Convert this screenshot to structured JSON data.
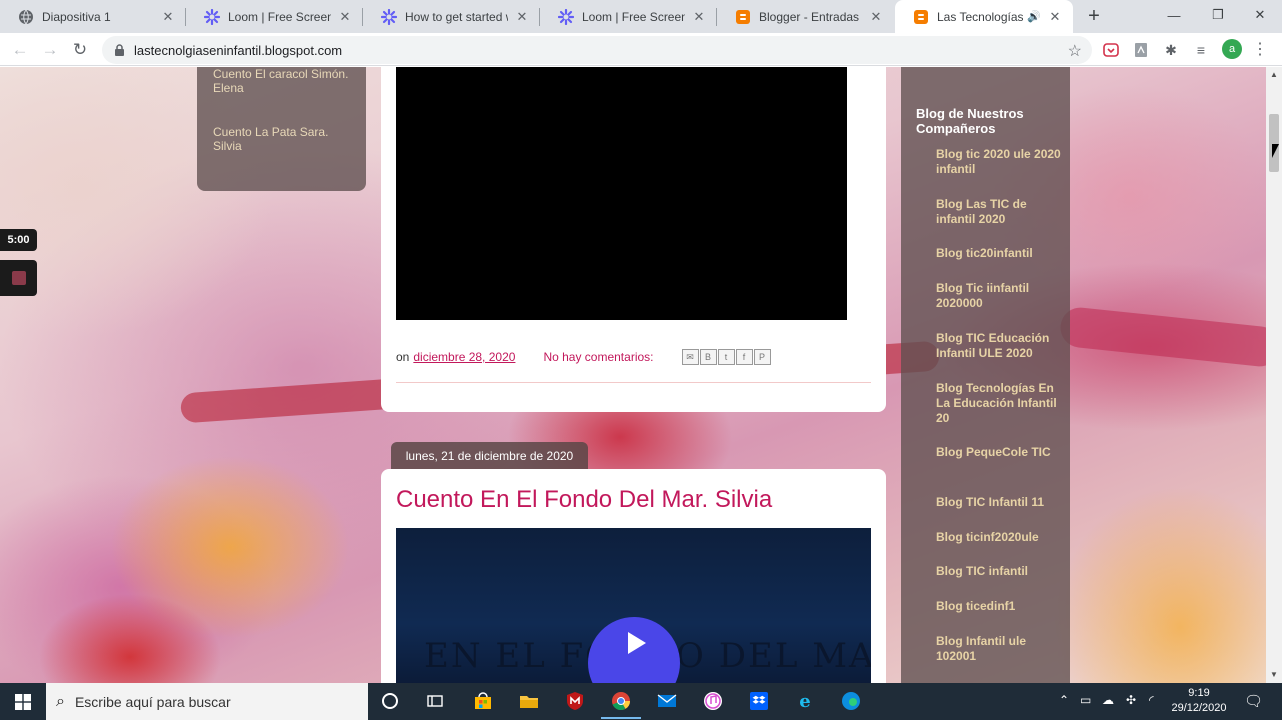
{
  "browser": {
    "tabs": [
      {
        "title": "Diapositiva 1",
        "icon": "globe-icon"
      },
      {
        "title": "Loom | Free Screen & Vi",
        "icon": "loom-icon"
      },
      {
        "title": "How to get started with",
        "icon": "loom-icon"
      },
      {
        "title": "Loom | Free Screen & Vi",
        "icon": "loom-icon"
      },
      {
        "title": "Blogger - Entradas",
        "icon": "blogger-icon"
      },
      {
        "title": "Las Tecnologías en",
        "icon": "blogger-icon",
        "active": true
      }
    ],
    "url": "lastecnolgiaseninfantil.blogspot.com",
    "profile_initial": "a"
  },
  "page": {
    "left_links": [
      "Cuento El caracol Simón. Elena",
      "Cuento La Pata Sara. Silvia"
    ],
    "loom_timer": "5:00",
    "post1": {
      "footer_prefix": "on",
      "date": "diciembre 28, 2020",
      "comments": "No hay comentarios:"
    },
    "post2": {
      "date_header": "lunes, 21 de diciembre de 2020",
      "title": "Cuento En El Fondo Del Mar. Silvia",
      "video_art_text": "EN EL FONDO DEL MAR"
    },
    "sidebar": {
      "heading": "Blog de Nuestros Compañeros",
      "links": [
        "Blog tic 2020 ule 2020 infantil",
        "Blog Las TIC de infantil 2020",
        "Blog tic20infantil",
        "Blog Tic iinfantil 2020000",
        "Blog TIC Educación Infantil ULE 2020",
        "Blog Tecnologías En La Educación Infantil 20",
        "Blog PequeCole TIC",
        "Blog TIC Infantil 11",
        "Blog ticinf2020ule",
        "Blog TIC infantil",
        "Blog ticedinf1",
        "Blog Infantil ule 102001"
      ]
    }
  },
  "taskbar": {
    "search_placeholder": "Escribe aquí para buscar",
    "time": "9:19",
    "date": "29/12/2020"
  },
  "colors": {
    "accent_link": "#c2185b",
    "sidebar_link": "#e7d3a6",
    "loom_play": "#4a46e8",
    "taskbar_bg": "#1f2c38"
  }
}
